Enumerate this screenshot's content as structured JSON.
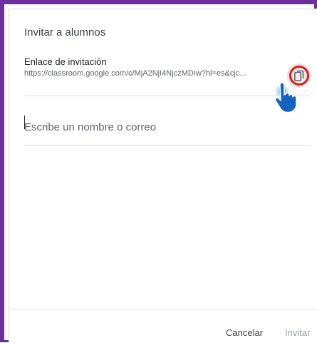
{
  "dialog": {
    "title": "Invitar a alumnos",
    "link_label": "Enlace de invitación",
    "link_url": "https://classroom.google.com/c/MjA2NjI4NjczMDIw?hl=es&cjc..."
  },
  "search": {
    "placeholder": "Escribe un nombre o correo"
  },
  "footer": {
    "cancel_label": "Cancelar",
    "invite_label": "Invitar"
  },
  "icons": {
    "copy": "copy-icon",
    "cursor": "pointer-hand-cursor-icon"
  },
  "colors": {
    "frame": "#6b2fa0",
    "highlight_ring": "#e01b1b",
    "cursor_blue": "#1565c0"
  }
}
